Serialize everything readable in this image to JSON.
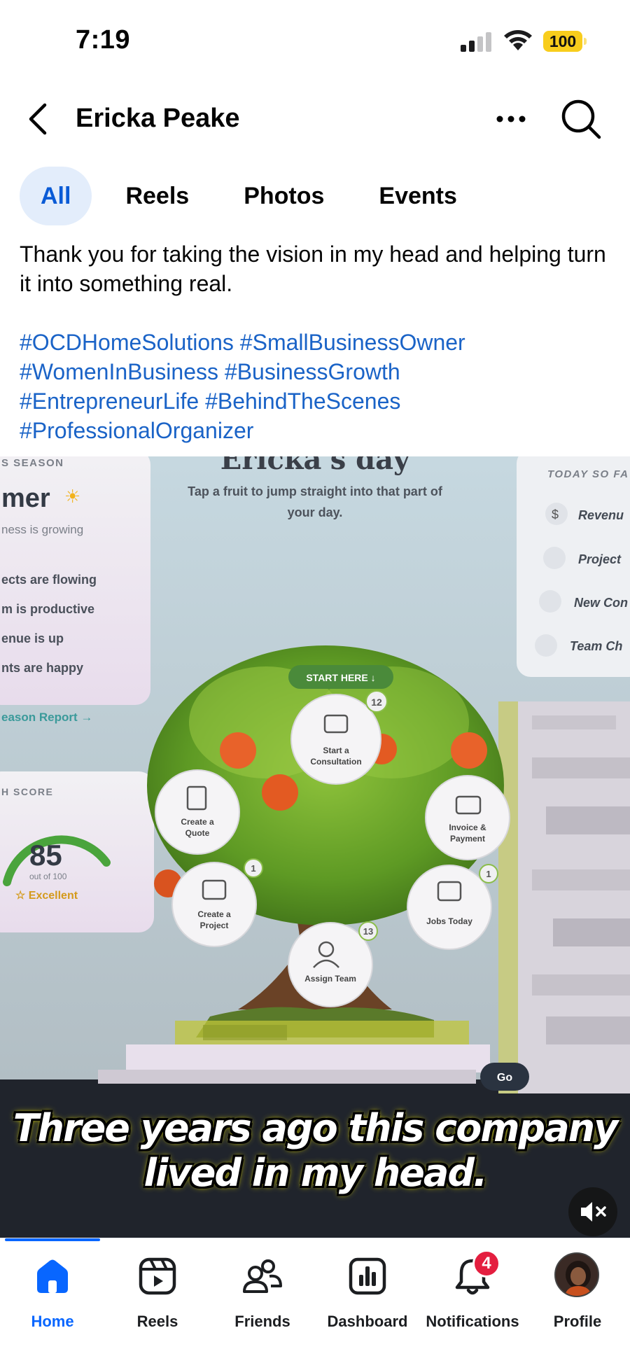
{
  "status_bar": {
    "time": "7:19",
    "battery": "100"
  },
  "header": {
    "title": "Ericka Peake"
  },
  "tabs": [
    {
      "label": "All",
      "active": true
    },
    {
      "label": "Reels",
      "active": false
    },
    {
      "label": "Photos",
      "active": false
    },
    {
      "label": "Events",
      "active": false
    }
  ],
  "post": {
    "text": "Thank you for taking the vision in my head and helping turn it into something real.",
    "hashtags": [
      "#OCDHomeSolutions",
      "#SmallBusinessOwner",
      "#WomenInBusiness",
      "#BusinessGrowth",
      "#EntrepreneurLife",
      "#BehindTheScenes",
      "#ProfessionalOrganizer"
    ]
  },
  "video": {
    "screen": {
      "title": "Ericka's day",
      "subtitle_line1": "Tap a fruit to jump straight into that part of",
      "subtitle_line2": "your day.",
      "left_panel": {
        "header": "S SEASON",
        "season": "mer",
        "growth": "ness is growing",
        "bullets": [
          "ects are flowing",
          "m is productive",
          "enue is up",
          "nts are happy"
        ],
        "report_link": "eason Report →"
      },
      "score_panel": {
        "header": "H SCORE",
        "score": "85",
        "out_of": "out of 100",
        "rating": "☆ Excellent"
      },
      "right_panel": {
        "header": "TODAY SO FA",
        "items": [
          "Revenu",
          "Project",
          "New Con",
          "Team Ch"
        ]
      },
      "start_here": "START HERE ↓",
      "fruits": [
        {
          "line1": "Start a",
          "line2": "Consultation",
          "badge": "12"
        },
        {
          "line1": "Create a",
          "line2": "Quote",
          "badge": ""
        },
        {
          "line1": "Invoice &",
          "line2": "Payment",
          "badge": ""
        },
        {
          "line1": "Create a",
          "line2": "Project",
          "badge": "1"
        },
        {
          "line1": "Jobs Today",
          "line2": "",
          "badge": "1"
        },
        {
          "line1": "Assign Team",
          "line2": "",
          "badge": "13"
        }
      ],
      "go_button": "Go"
    },
    "caption_line1": "Three years ago this company",
    "caption_line2": "lived in my head."
  },
  "bottom_nav": [
    {
      "label": "Home",
      "icon": "home-icon",
      "active": true
    },
    {
      "label": "Reels",
      "icon": "reels-icon",
      "active": false
    },
    {
      "label": "Friends",
      "icon": "friends-icon",
      "active": false
    },
    {
      "label": "Dashboard",
      "icon": "dashboard-icon",
      "active": false
    },
    {
      "label": "Notifications",
      "icon": "bell-icon",
      "active": false,
      "badge": "4"
    },
    {
      "label": "Profile",
      "icon": "avatar",
      "active": false
    }
  ],
  "colors": {
    "accent": "#0866ff",
    "hashtag": "#1a63c7",
    "tab_active_bg": "#e3edfb",
    "badge": "#e41e3f",
    "battery": "#f8cd1c"
  }
}
